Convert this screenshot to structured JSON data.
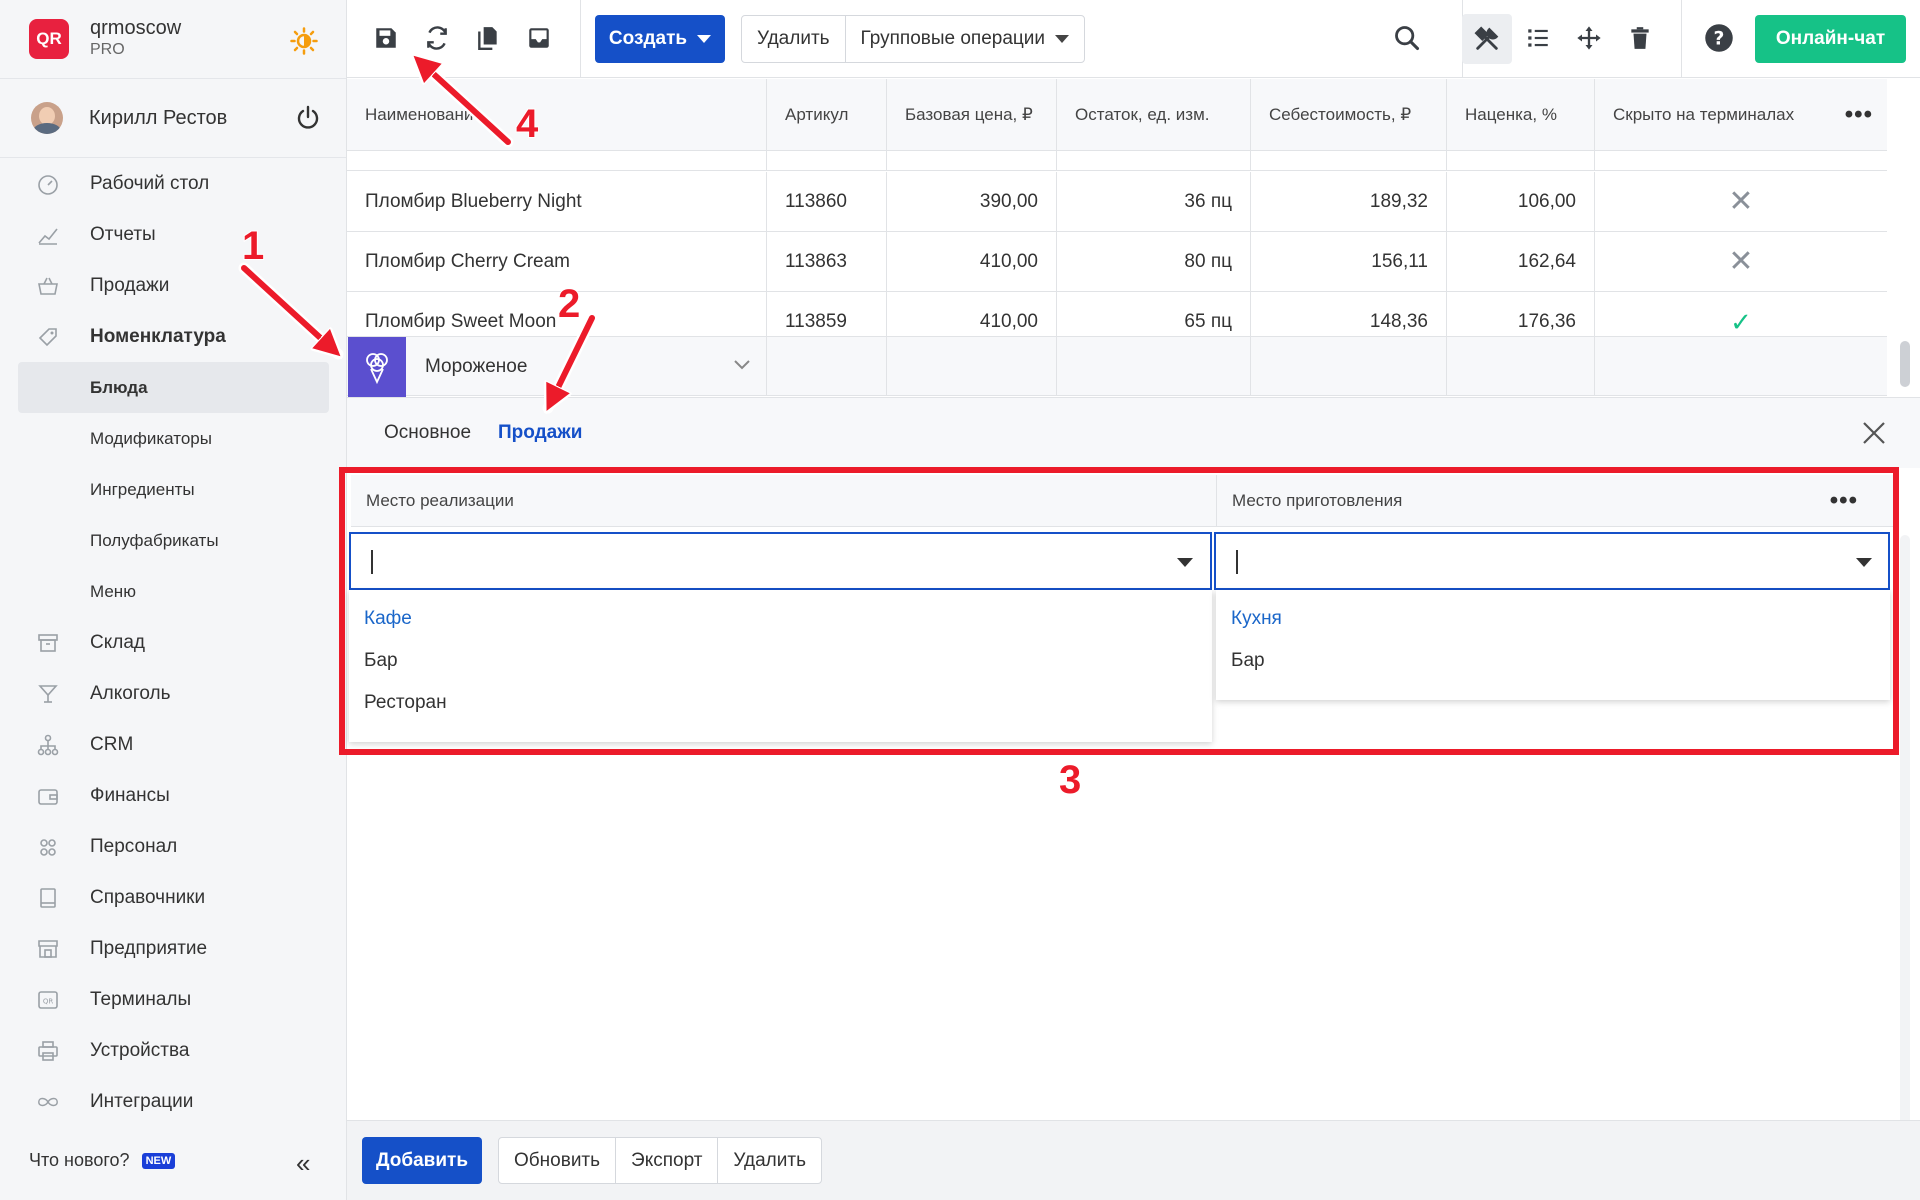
{
  "brand": {
    "logo": "QR",
    "name": "qrmoscow",
    "plan": "PRO"
  },
  "user": {
    "name": "Кирилл Рестов"
  },
  "nav": {
    "items": [
      {
        "label": "Рабочий стол",
        "icon": "dashboard-icon"
      },
      {
        "label": "Отчеты",
        "icon": "chart-icon"
      },
      {
        "label": "Продажи",
        "icon": "basket-icon"
      },
      {
        "label": "Номенклатура",
        "icon": "tag-icon"
      }
    ],
    "sub": [
      {
        "label": "Блюда",
        "active": true
      },
      {
        "label": "Модификаторы"
      },
      {
        "label": "Ингредиенты"
      },
      {
        "label": "Полуфабрикаты"
      },
      {
        "label": "Меню"
      }
    ],
    "items2": [
      {
        "label": "Склад",
        "icon": "box-icon"
      },
      {
        "label": "Алкоголь",
        "icon": "glass-icon"
      },
      {
        "label": "CRM",
        "icon": "hierarchy-icon"
      },
      {
        "label": "Финансы",
        "icon": "wallet-icon"
      },
      {
        "label": "Персонал",
        "icon": "people-icon"
      },
      {
        "label": "Справочники",
        "icon": "book-icon"
      },
      {
        "label": "Предприятие",
        "icon": "store-icon"
      },
      {
        "label": "Терминалы",
        "icon": "terminal-icon"
      },
      {
        "label": "Устройства",
        "icon": "printer-icon"
      },
      {
        "label": "Интеграции",
        "icon": "infinity-icon"
      }
    ]
  },
  "whats_new": {
    "label": "Что нового?",
    "badge": "NEW"
  },
  "toolbar": {
    "create": "Создать",
    "delete": "Удалить",
    "group_ops": "Групповые операции",
    "chat": "Онлайн-чат"
  },
  "table": {
    "columns": [
      "Наименование",
      "Артикул",
      "Базовая цена, ₽",
      "Остаток, ед. изм.",
      "Себестоимость, ₽",
      "Наценка, %",
      "Скрыто на терминалах"
    ],
    "rows": [
      {
        "name": "Пломбир Blueberry Night",
        "sku": "113860",
        "price": "390,00",
        "stock": "36 пц",
        "cost": "189,32",
        "markup": "106,00",
        "hidden": false
      },
      {
        "name": "Пломбир Cherry Cream",
        "sku": "113863",
        "price": "410,00",
        "stock": "80 пц",
        "cost": "156,11",
        "markup": "162,64",
        "hidden": false
      },
      {
        "name": "Пломбир Sweet Moon",
        "sku": "113859",
        "price": "410,00",
        "stock": "65 пц",
        "cost": "148,36",
        "markup": "176,36",
        "hidden": true
      }
    ],
    "group": {
      "label": "Мороженое",
      "icon": "ice-cream-icon"
    }
  },
  "detail": {
    "tabs": [
      "Основное",
      "Продажи"
    ],
    "active_tab": "Продажи",
    "sale_place": {
      "header": "Место реализации",
      "value": "",
      "options": [
        "Кафе",
        "Бар",
        "Ресторан"
      ]
    },
    "prep_place": {
      "header": "Место приготовления",
      "value": "",
      "options": [
        "Кухня",
        "Бар"
      ]
    }
  },
  "footer": {
    "add": "Добавить",
    "refresh": "Обновить",
    "export": "Экспорт",
    "delete": "Удалить"
  },
  "annotations": {
    "n1": "1",
    "n2": "2",
    "n3": "3",
    "n4": "4"
  },
  "colors": {
    "primary": "#1550c8",
    "chat": "#16c287",
    "brand": "#e8213f",
    "annotation": "#ec1b2a",
    "group_icon_bg": "#5b4fcf"
  }
}
